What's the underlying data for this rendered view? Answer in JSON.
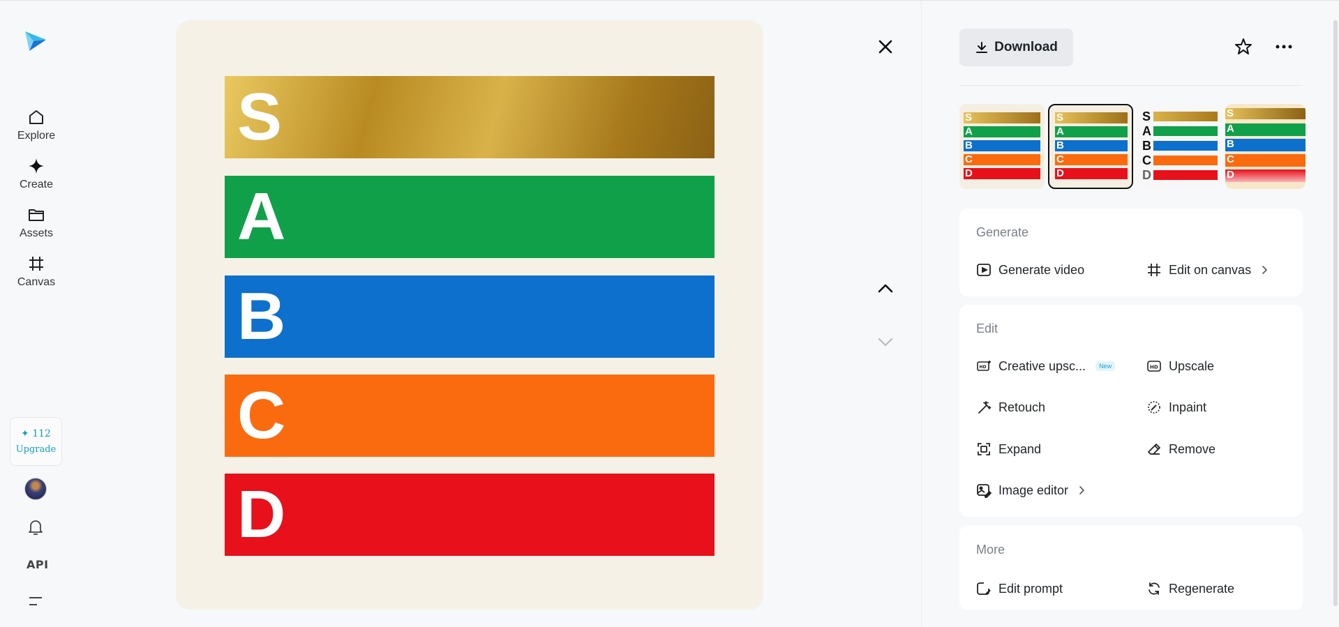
{
  "sidebar": {
    "nav": [
      {
        "label": "Explore",
        "icon": "home-icon"
      },
      {
        "label": "Create",
        "icon": "sparkle-icon"
      },
      {
        "label": "Assets",
        "icon": "folder-icon"
      },
      {
        "label": "Canvas",
        "icon": "canvas-icon"
      }
    ],
    "credits": {
      "count": "✦ 112",
      "upgrade_label": "Upgrade"
    },
    "api_label": "API"
  },
  "image": {
    "tiers": [
      {
        "letter": "S",
        "color": "#c99a2e"
      },
      {
        "letter": "A",
        "color": "#11a04a"
      },
      {
        "letter": "B",
        "color": "#0c70cc"
      },
      {
        "letter": "C",
        "color": "#fa6b10"
      },
      {
        "letter": "D",
        "color": "#e8101a"
      }
    ]
  },
  "panel": {
    "download_label": "Download",
    "generate": {
      "title": "Generate",
      "actions": {
        "video": "Generate video",
        "canvas": "Edit on canvas"
      }
    },
    "edit": {
      "title": "Edit",
      "actions": {
        "creative_upscale": "Creative upsc...",
        "new_badge": "New",
        "upscale": "Upscale",
        "retouch": "Retouch",
        "inpaint": "Inpaint",
        "expand": "Expand",
        "remove": "Remove",
        "image_editor": "Image editor"
      }
    },
    "more": {
      "title": "More",
      "actions": {
        "edit_prompt": "Edit prompt",
        "regenerate": "Regenerate"
      }
    }
  },
  "colors": {
    "accent": "#139fc4",
    "gold": "#c99a2e",
    "green": "#11a04a",
    "blue": "#0c70cc",
    "orange": "#fa6b10",
    "red": "#e8101a"
  }
}
